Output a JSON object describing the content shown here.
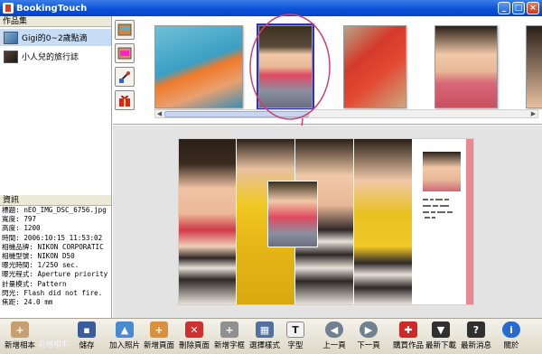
{
  "window": {
    "title": "BookingTouch",
    "controls": [
      "_",
      "□",
      "×"
    ]
  },
  "left_panel": {
    "albums_heading": "作品集",
    "albums": [
      {
        "label": "Gigi的0~2歲點滴"
      },
      {
        "label": "小人兒的旅行誌"
      }
    ],
    "info_heading": "資訊",
    "info_lines": [
      "標題: nEO_IMG_DSC_6756.jpg",
      "寬度: 797",
      "高度: 1200",
      "時間: 2006:10:15 11:53:02",
      "相機品牌: NIKON CORPORATIC",
      "相機型號: NIKON D50",
      "曝光時間: 1/250 sec.",
      "曝光程式: Aperture priority",
      "計量模式: Pattern",
      "閃光: Flash did not fire.",
      "焦距: 24.0 mm"
    ]
  },
  "toolbar": {
    "buttons": [
      {
        "label": "新增相本"
      },
      {
        "label": "儲存"
      },
      {
        "label": "加入照片"
      },
      {
        "label": "新增頁面"
      },
      {
        "label": "刪除頁面"
      },
      {
        "label": "新增字框"
      },
      {
        "label": "選擇樣式"
      },
      {
        "label": "字型"
      },
      {
        "label": "上一頁"
      },
      {
        "label": "下一頁"
      },
      {
        "label": "購買作品"
      },
      {
        "label": "最新下載"
      },
      {
        "label": "最新消息"
      },
      {
        "label": "關於"
      }
    ],
    "ghost_label": "新增相本"
  },
  "colors": {
    "titlebar": "#0a4fd6",
    "selection_outline": "#3030c0",
    "annotation_circle": "#d04070",
    "page_accent": "#e88a96"
  }
}
